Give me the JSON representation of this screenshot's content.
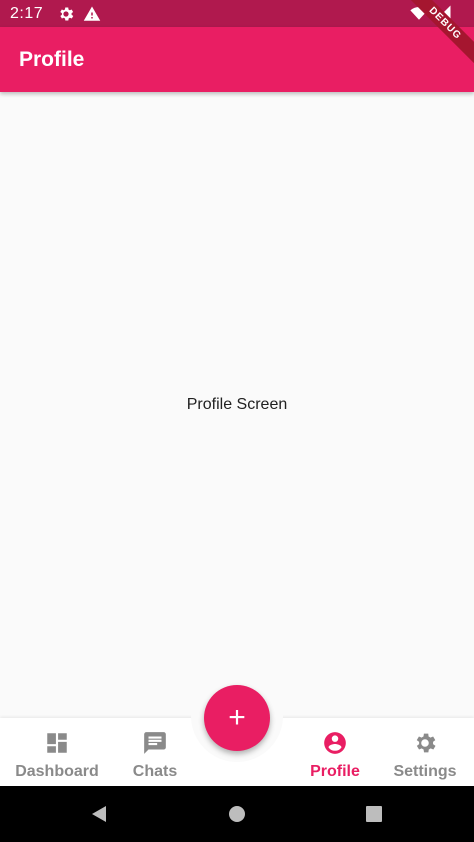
{
  "status_bar": {
    "time": "2:17",
    "icons": [
      "gear-icon",
      "warning-icon",
      "wifi-icon",
      "signal-icon"
    ]
  },
  "debug_banner": "DEBUG",
  "app_bar": {
    "title": "Profile"
  },
  "content": {
    "message": "Profile Screen"
  },
  "fab": {
    "label": "+"
  },
  "bottom_nav": {
    "items": [
      {
        "label": "Dashboard",
        "icon": "dashboard-icon",
        "active": false
      },
      {
        "label": "Chats",
        "icon": "chat-icon",
        "active": false
      },
      {
        "label": "Profile",
        "icon": "account-circle-icon",
        "active": true
      },
      {
        "label": "Settings",
        "icon": "gear-icon",
        "active": false
      }
    ]
  },
  "system_nav": {
    "buttons": [
      "back-icon",
      "home-icon",
      "recents-icon"
    ]
  },
  "colors": {
    "primary": "#e91e63",
    "status_bar": "#b0194e",
    "inactive": "#8a8a8a"
  }
}
